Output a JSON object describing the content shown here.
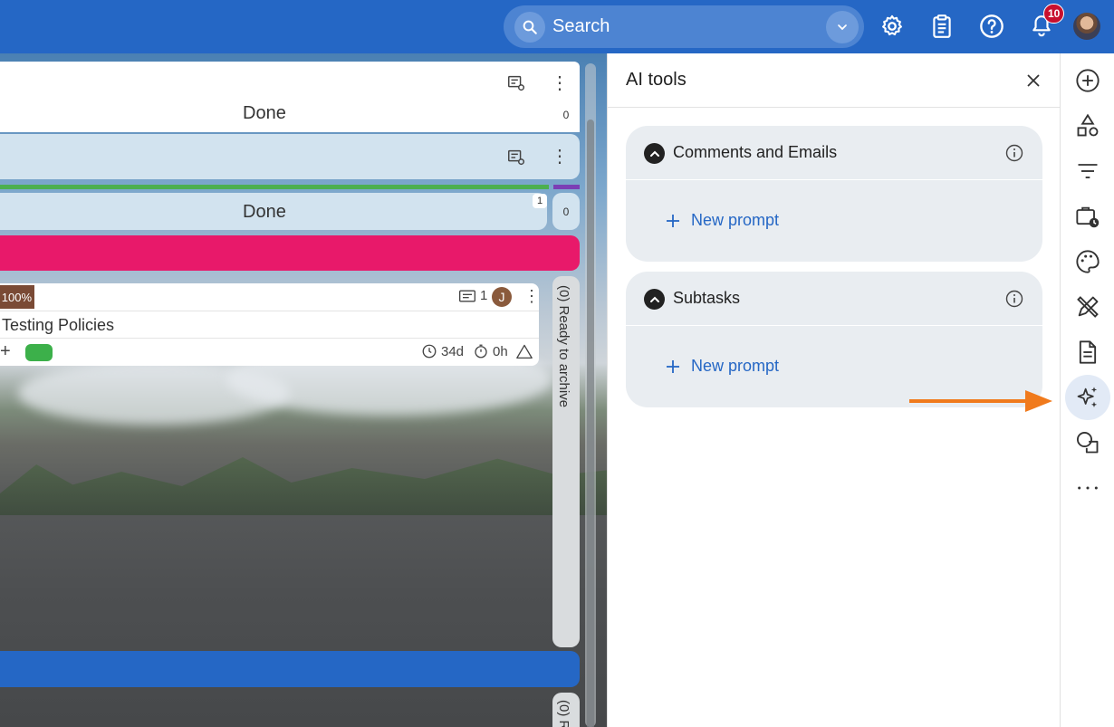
{
  "topbar": {
    "search_placeholder": "Search",
    "notifications_count": "10"
  },
  "board": {
    "lane1": {
      "status": "Done",
      "count": "0"
    },
    "lane2": {
      "status": "Done",
      "count": "0",
      "badge": "1"
    },
    "card": {
      "progress": "100%",
      "title": "Testing Policies",
      "comments": "1",
      "assignee_initial": "J",
      "age": "34d",
      "time": "0h"
    },
    "archive_column": "(0) Ready to archive",
    "archive_column_2": "(0) R"
  },
  "panel": {
    "title": "AI tools",
    "sections": [
      {
        "title": "Comments and Emails",
        "action": "New prompt"
      },
      {
        "title": "Subtasks",
        "action": "New prompt"
      }
    ]
  },
  "colors": {
    "topbar": "#2567c5",
    "accent": "#2567c5",
    "pink_bar": "#e8196a",
    "arrow": "#f07a1c"
  }
}
